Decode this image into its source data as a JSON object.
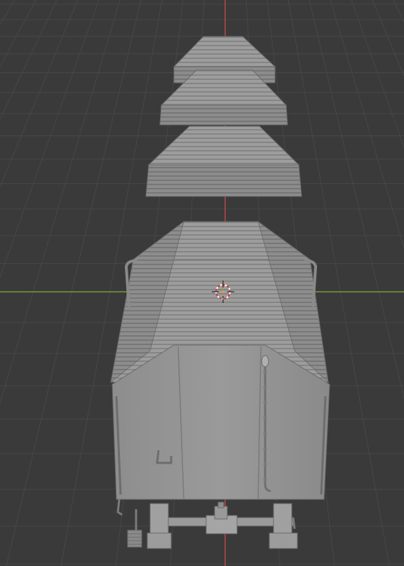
{
  "viewport": {
    "background": "#3a3a3a",
    "grid_color": "#464646",
    "x_axis_color": "#6f9b3a",
    "y_axis_color": "#b5494b",
    "object_color": "#9a9a9a",
    "shade_color": "#8a8a8a",
    "dark_color": "#6d6d6d",
    "light_color": "#b0b0b0",
    "object_name": "boxcar",
    "cursor_icon": "3d-cursor-icon"
  }
}
